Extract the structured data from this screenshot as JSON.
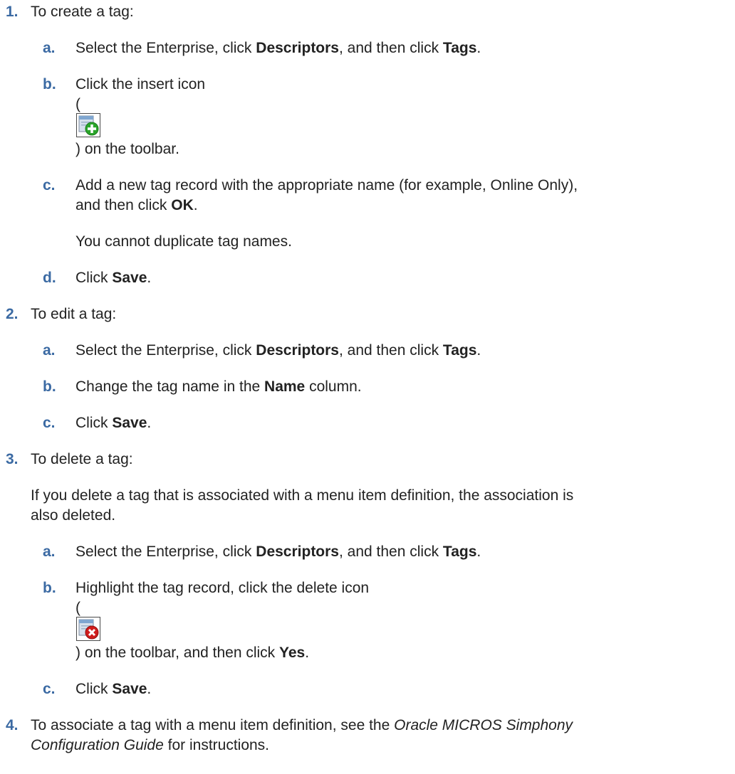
{
  "steps": [
    {
      "number": "1.",
      "text": "To create a tag:",
      "substeps": [
        {
          "letter": "a.",
          "t1": "Select the Enterprise, click ",
          "b1": "Descriptors",
          "t2": ", and then click ",
          "b2": "Tags",
          "t3": "."
        },
        {
          "letter": "b.",
          "line1": "Click the insert icon",
          "open_paren": "(",
          "icon": "insert-icon",
          "line2": ") on the toolbar."
        },
        {
          "letter": "c.",
          "line1": "Add a new tag record with the appropriate name (for example, Online Only),",
          "t1": "and then click ",
          "b1": "OK",
          "t2": ".",
          "note": "You cannot duplicate tag names."
        },
        {
          "letter": "d.",
          "t1": "Click ",
          "b1": "Save",
          "t2": "."
        }
      ]
    },
    {
      "number": "2.",
      "text": "To edit a tag:",
      "substeps": [
        {
          "letter": "a.",
          "t1": "Select the Enterprise, click ",
          "b1": "Descriptors",
          "t2": ", and then click ",
          "b2": "Tags",
          "t3": "."
        },
        {
          "letter": "b.",
          "t1": "Change the tag name in the ",
          "b1": "Name",
          "t2": " column."
        },
        {
          "letter": "c.",
          "t1": "Click ",
          "b1": "Save",
          "t2": "."
        }
      ]
    },
    {
      "number": "3.",
      "text": "To delete a tag:",
      "note_line1": "If you delete a tag that is associated with a menu item definition, the association is",
      "note_line2": "also deleted.",
      "substeps": [
        {
          "letter": "a.",
          "t1": "Select the Enterprise, click ",
          "b1": "Descriptors",
          "t2": ", and then click ",
          "b2": "Tags",
          "t3": "."
        },
        {
          "letter": "b.",
          "line1": "Highlight the tag record, click the delete icon",
          "open_paren": "(",
          "icon": "delete-icon",
          "t1": ") on the toolbar, and then click ",
          "b1": "Yes",
          "t2": "."
        },
        {
          "letter": "c.",
          "t1": "Click ",
          "b1": "Save",
          "t2": "."
        }
      ]
    },
    {
      "number": "4.",
      "line1_text": "To associate a tag with a menu item definition, see the ",
      "line1_italic": "Oracle MICROS Simphony",
      "line2_italic": "Configuration Guide",
      "line2_text": " for instructions."
    }
  ],
  "colors": {
    "step_number": "#3b6aa3",
    "text": "#222222",
    "insert_icon_circle": "#2aa52a",
    "delete_icon_circle": "#d01c1c"
  }
}
